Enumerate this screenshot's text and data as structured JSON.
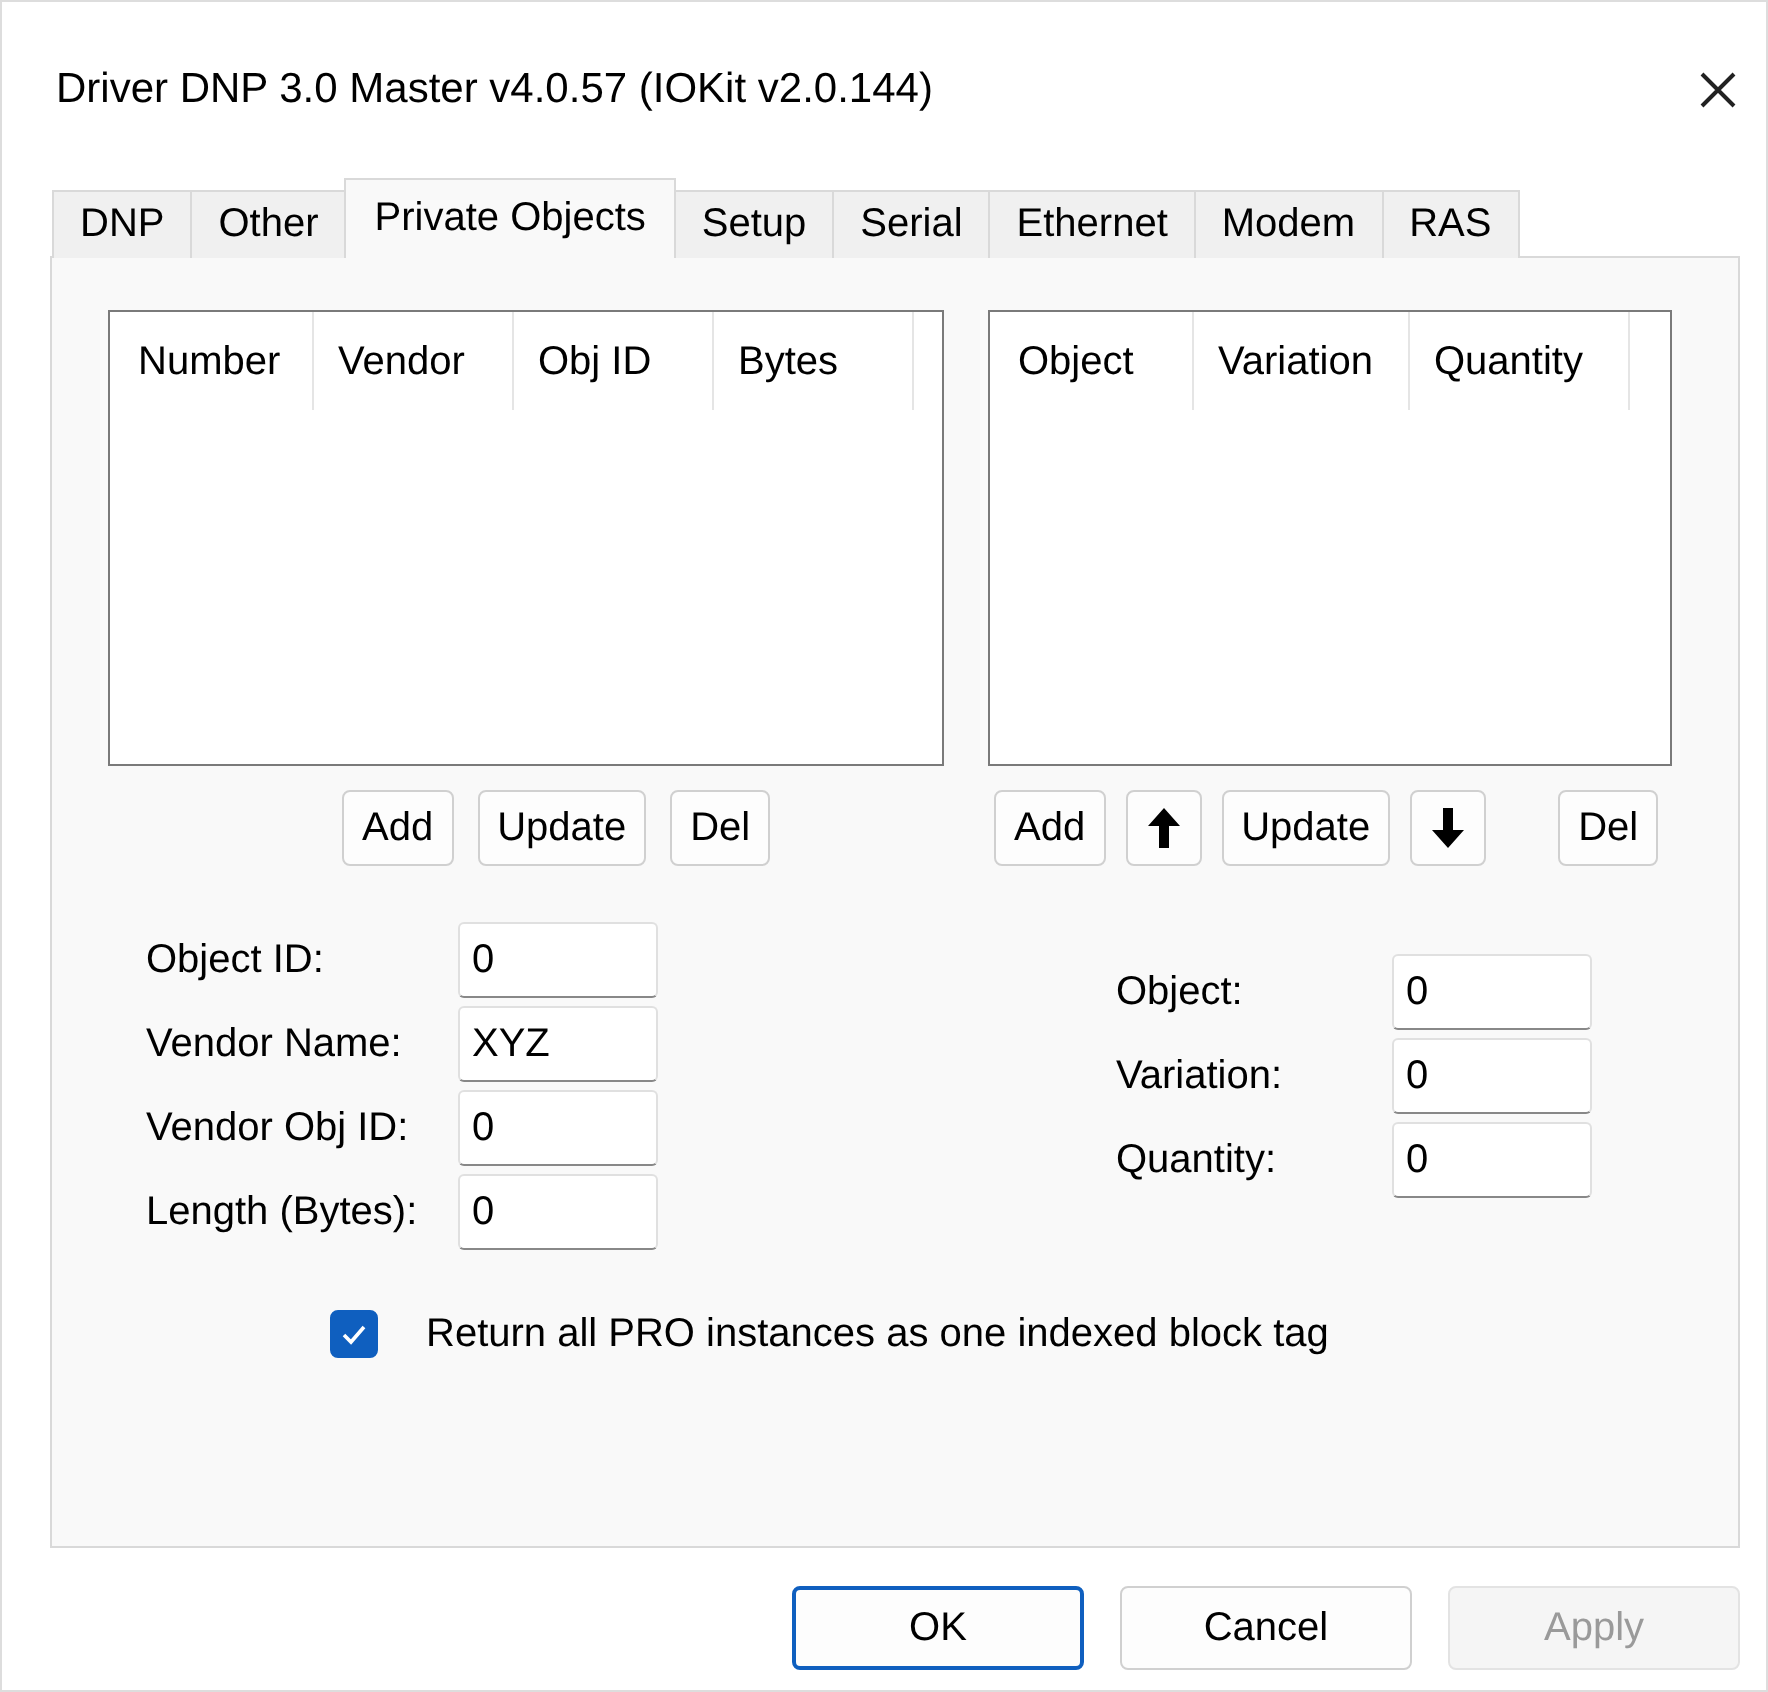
{
  "window": {
    "title": "Driver DNP 3.0 Master v4.0.57 (IOKit v2.0.144)"
  },
  "tabs": [
    {
      "label": "DNP",
      "selected": false
    },
    {
      "label": "Other",
      "selected": false
    },
    {
      "label": "Private Objects",
      "selected": true
    },
    {
      "label": "Setup",
      "selected": false
    },
    {
      "label": "Serial",
      "selected": false
    },
    {
      "label": "Ethernet",
      "selected": false
    },
    {
      "label": "Modem",
      "selected": false
    },
    {
      "label": "RAS",
      "selected": false
    }
  ],
  "left_list": {
    "columns": [
      "Number",
      "Vendor",
      "Obj ID",
      "Bytes"
    ],
    "buttons": [
      {
        "kind": "text",
        "label": "Add"
      },
      {
        "kind": "text",
        "label": "Update"
      },
      {
        "kind": "text",
        "label": "Del"
      }
    ]
  },
  "right_list": {
    "columns": [
      "Object",
      "Variation",
      "Quantity"
    ],
    "buttons": [
      {
        "kind": "text",
        "label": "Add"
      },
      {
        "kind": "up"
      },
      {
        "kind": "text",
        "label": "Update"
      },
      {
        "kind": "down"
      },
      {
        "kind": "text",
        "label": "Del"
      }
    ]
  },
  "left_fields": [
    {
      "label": "Object ID:",
      "value": "0"
    },
    {
      "label": "Vendor Name:",
      "value": "XYZ"
    },
    {
      "label": "Vendor Obj ID:",
      "value": "0"
    },
    {
      "label": "Length (Bytes):",
      "value": "0"
    }
  ],
  "right_fields": [
    {
      "label": "Object:",
      "value": "0"
    },
    {
      "label": "Variation:",
      "value": "0"
    },
    {
      "label": "Quantity:",
      "value": "0"
    }
  ],
  "checkbox": {
    "label": "Return all PRO instances as one indexed block tag",
    "checked": true
  },
  "footer_buttons": [
    {
      "label": "OK",
      "default": true,
      "disabled": false
    },
    {
      "label": "Cancel",
      "default": false,
      "disabled": false
    },
    {
      "label": "Apply",
      "default": false,
      "disabled": true
    }
  ]
}
